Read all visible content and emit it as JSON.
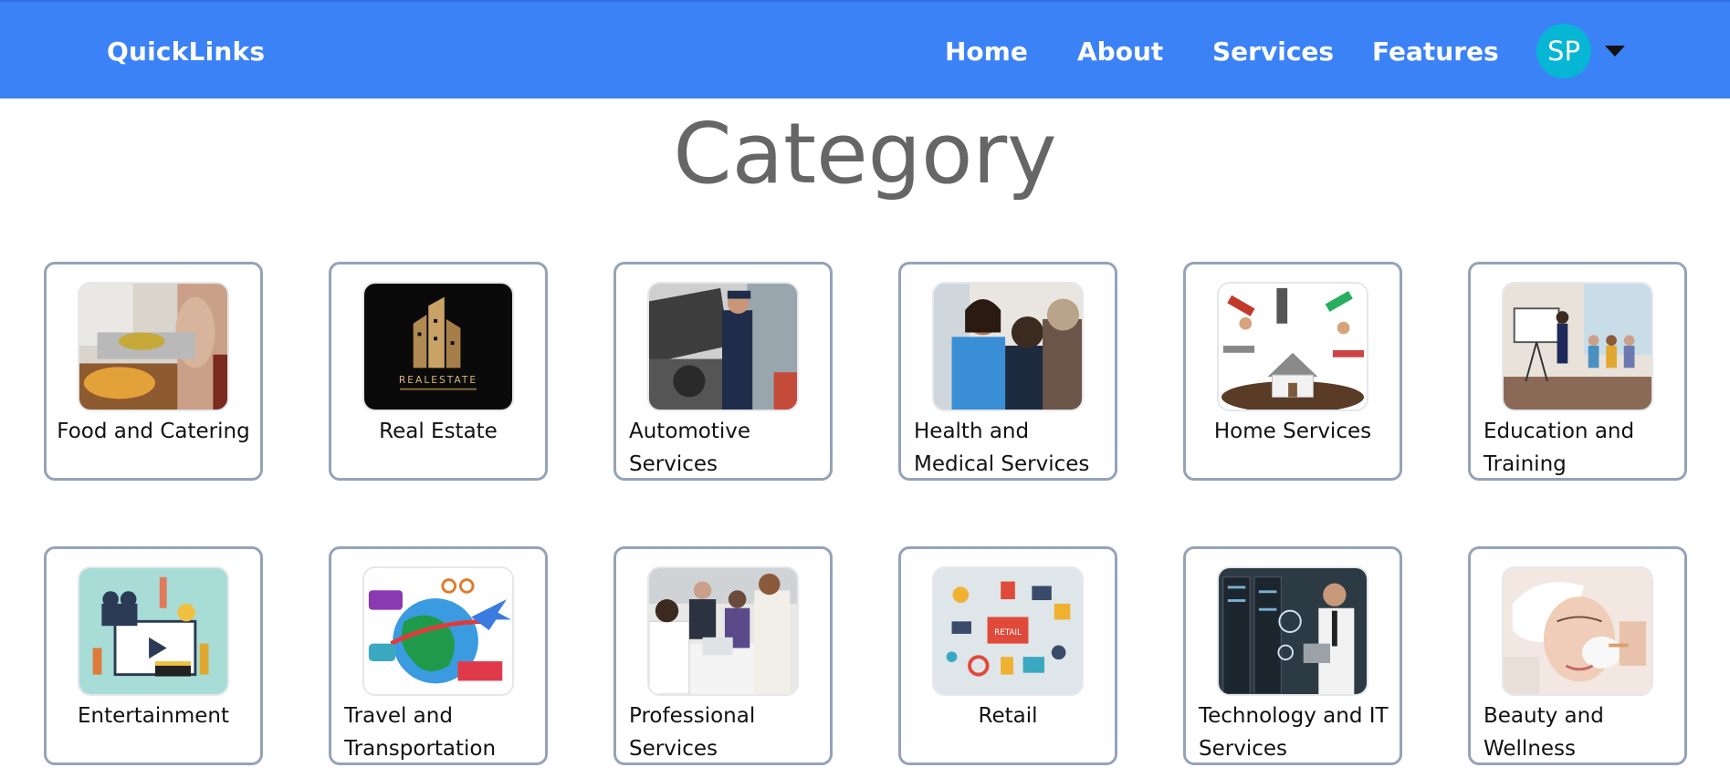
{
  "navbar": {
    "brand": "QuickLinks",
    "links": [
      "Home",
      "About",
      "Services",
      "Features"
    ],
    "avatar_initials": "SP"
  },
  "page": {
    "title": "Category"
  },
  "categories": [
    {
      "label": "Food and Catering",
      "icon": "food-catering-image"
    },
    {
      "label": "Real Estate",
      "icon": "real-estate-logo-image",
      "image_text": "REALESTATE"
    },
    {
      "label": "Automotive Services",
      "icon": "mechanic-image"
    },
    {
      "label": "Health and Medical Services",
      "icon": "doctor-patient-image"
    },
    {
      "label": "Home Services",
      "icon": "tools-house-image"
    },
    {
      "label": "Education and Training",
      "icon": "classroom-presentation-image"
    },
    {
      "label": "Entertainment",
      "icon": "film-production-image"
    },
    {
      "label": "Travel and Transportation",
      "icon": "globe-vehicles-image"
    },
    {
      "label": "Professional Services",
      "icon": "business-meeting-image"
    },
    {
      "label": "Retail",
      "icon": "retail-icons-image",
      "image_text": "RETAIL"
    },
    {
      "label": "Technology and IT Services",
      "icon": "server-room-image"
    },
    {
      "label": "Beauty and Wellness",
      "icon": "facial-treatment-image"
    }
  ],
  "colors": {
    "navbar": "#3b82f6",
    "avatar": "#06b6d4",
    "card_border": "#94a3b8",
    "title": "#666666"
  }
}
